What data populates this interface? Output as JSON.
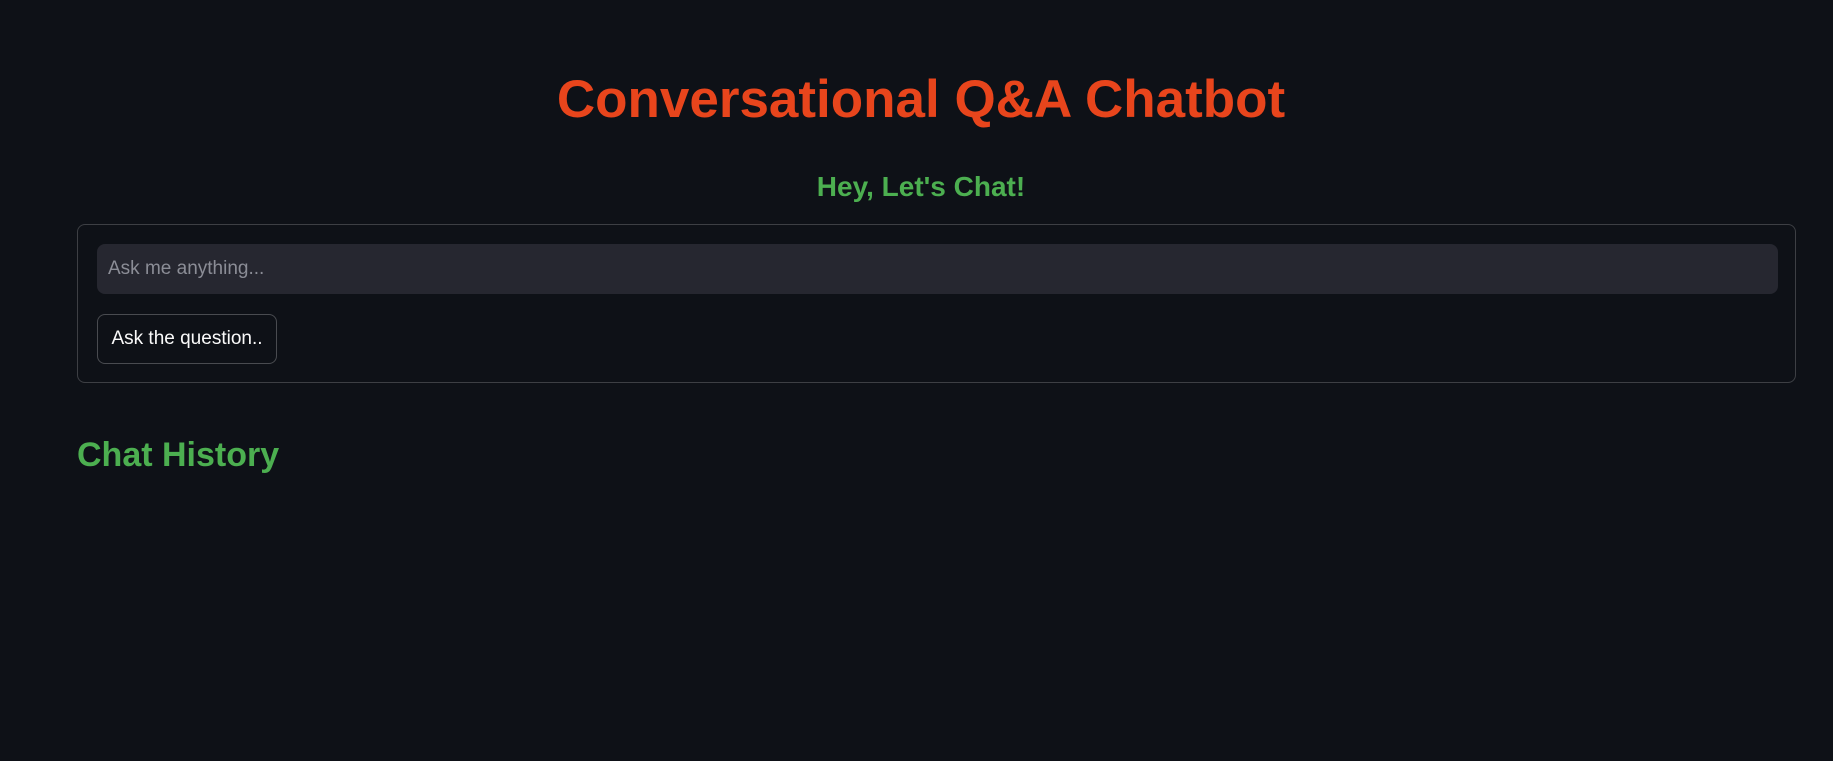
{
  "header": {
    "title": "Conversational Q&A Chatbot",
    "subtitle": "Hey, Let's Chat!"
  },
  "form": {
    "input_value": "",
    "input_placeholder": "Ask me anything...",
    "submit_label": "Ask the question.."
  },
  "history": {
    "heading": "Chat History",
    "messages": []
  },
  "colors": {
    "background": "#0e1117",
    "title": "#e8451c",
    "accent_green": "#4caf50",
    "input_background": "#262730",
    "text": "#fafafa"
  }
}
